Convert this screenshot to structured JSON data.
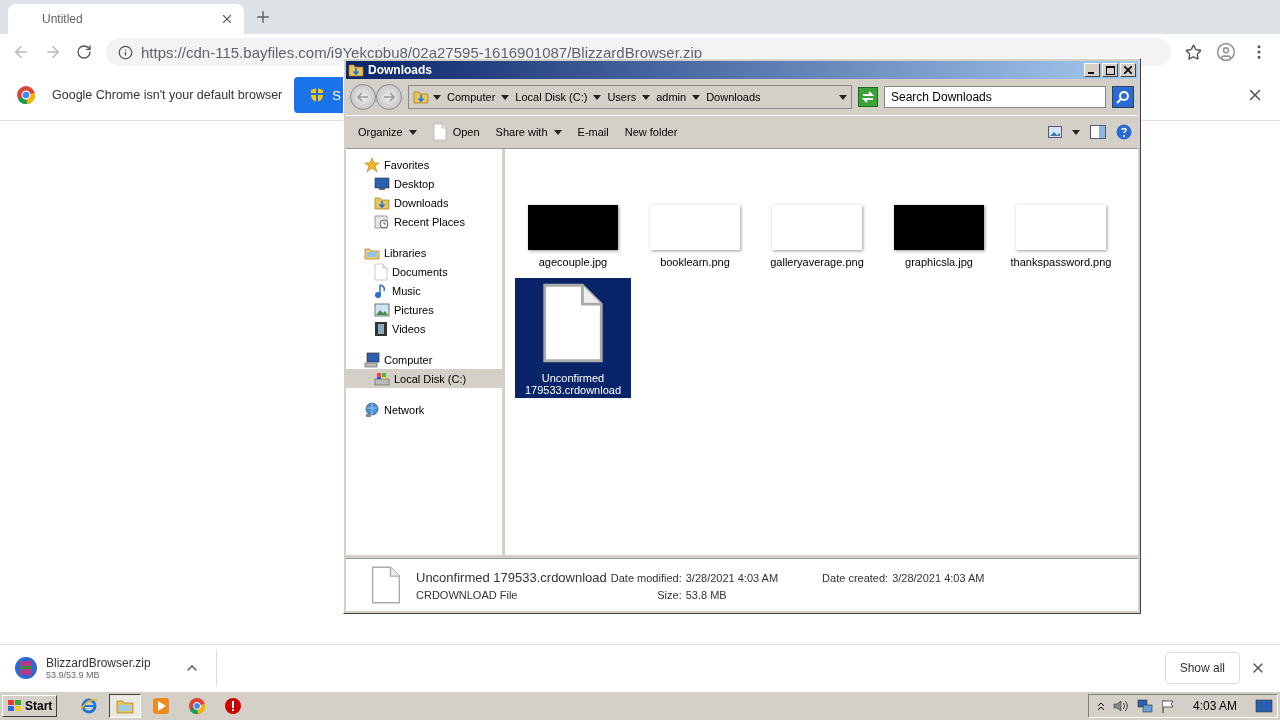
{
  "browser": {
    "tab": {
      "title": "Untitled",
      "selected": true
    },
    "url": "https://cdn-115.bayfiles.com/i9Yekcpbu8/02a27595-1616901087/BlizzardBrowser.zip",
    "infobar": {
      "message": "Google Chrome isn't your default browser",
      "button_label": "S"
    },
    "download": {
      "file_name": "BlizzardBrowser.zip",
      "progress": "53.9/53.9 MB",
      "show_all": "Show all"
    }
  },
  "explorer": {
    "title": "Downloads",
    "breadcrumb": [
      "Computer",
      "Local Disk (C:)",
      "Users",
      "admin",
      "Downloads"
    ],
    "search": {
      "placeholder": "Search Downloads"
    },
    "toolbar": [
      {
        "label": "Organize",
        "kind": "menu"
      },
      {
        "label": "Open",
        "kind": "file-action"
      },
      {
        "label": "Share with",
        "kind": "menu"
      },
      {
        "label": "E-mail",
        "kind": "action"
      },
      {
        "label": "New folder",
        "kind": "action"
      }
    ],
    "nav": [
      {
        "label": "Favorites",
        "kind": "star",
        "selected": false,
        "children": [
          {
            "label": "Desktop",
            "kind": "desktop",
            "selected": false
          },
          {
            "label": "Downloads",
            "kind": "downloads",
            "selected": false
          },
          {
            "label": "Recent Places",
            "kind": "recent",
            "selected": false
          }
        ]
      },
      {
        "label": "Libraries",
        "kind": "libraries",
        "selected": false,
        "children": [
          {
            "label": "Documents",
            "kind": "documents",
            "selected": false
          },
          {
            "label": "Music",
            "kind": "music",
            "selected": false
          },
          {
            "label": "Pictures",
            "kind": "pictures",
            "selected": false
          },
          {
            "label": "Videos",
            "kind": "videos",
            "selected": false
          }
        ]
      },
      {
        "label": "Computer",
        "kind": "computer",
        "selected": false,
        "children": [
          {
            "label": "Local Disk (C:)",
            "kind": "disk",
            "selected": true
          }
        ]
      },
      {
        "label": "Network",
        "kind": "network",
        "selected": false
      }
    ],
    "files": [
      {
        "name": "agecouple.jpg",
        "kind": "dark",
        "selected": false
      },
      {
        "name": "booklearn.png",
        "kind": "light",
        "selected": false
      },
      {
        "name": "galleryaverage.png",
        "kind": "light",
        "selected": false
      },
      {
        "name": "graphicsla.jpg",
        "kind": "dark",
        "selected": false
      },
      {
        "name": "thankspassword.png",
        "kind": "light",
        "selected": false
      },
      {
        "name": "Unconfirmed 179533.crdownload",
        "kind": "document",
        "selected": true
      }
    ],
    "details": {
      "name": "Unconfirmed 179533.crdownload",
      "type": "CRDOWNLOAD File",
      "fields": [
        {
          "label": "Date modified:",
          "value": "3/28/2021 4:03 AM"
        },
        {
          "label": "Date created:",
          "value": "3/28/2021 4:03 AM"
        },
        {
          "label": "Size:",
          "value": "53.8 MB"
        }
      ]
    }
  },
  "taskbar": {
    "start": "Start",
    "apps": [
      {
        "kind": "ie",
        "active": false
      },
      {
        "kind": "explorer",
        "active": true
      },
      {
        "kind": "media",
        "active": false
      },
      {
        "kind": "chrome",
        "active": false
      },
      {
        "kind": "stop",
        "active": false
      }
    ],
    "time": "4:03 AM"
  }
}
